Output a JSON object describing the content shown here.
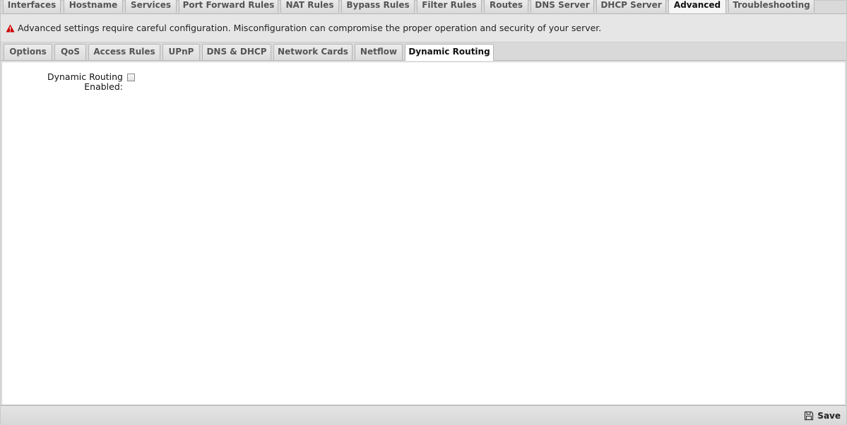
{
  "top_tabs": [
    {
      "label": "Interfaces"
    },
    {
      "label": "Hostname"
    },
    {
      "label": "Services"
    },
    {
      "label": "Port Forward Rules"
    },
    {
      "label": "NAT Rules"
    },
    {
      "label": "Bypass Rules"
    },
    {
      "label": "Filter Rules"
    },
    {
      "label": "Routes"
    },
    {
      "label": "DNS Server"
    },
    {
      "label": "DHCP Server"
    },
    {
      "label": "Advanced",
      "active": true
    },
    {
      "label": "Troubleshooting"
    }
  ],
  "warning": {
    "icon": "warning-triangle-icon",
    "text": "Advanced settings require careful configuration. Misconfiguration can compromise the proper operation and security of your server.",
    "color": "#cc0000"
  },
  "sub_tabs": [
    {
      "label": "Options"
    },
    {
      "label": "QoS"
    },
    {
      "label": "Access Rules"
    },
    {
      "label": "UPnP"
    },
    {
      "label": "DNS & DHCP"
    },
    {
      "label": "Network Cards"
    },
    {
      "label": "Netflow"
    },
    {
      "label": "Dynamic Routing",
      "active": true
    }
  ],
  "form": {
    "dynamic_routing_label": "Dynamic Routing Enabled:",
    "dynamic_routing_checked": false
  },
  "footer": {
    "save_label": "Save",
    "save_icon": "floppy-disk-icon"
  }
}
